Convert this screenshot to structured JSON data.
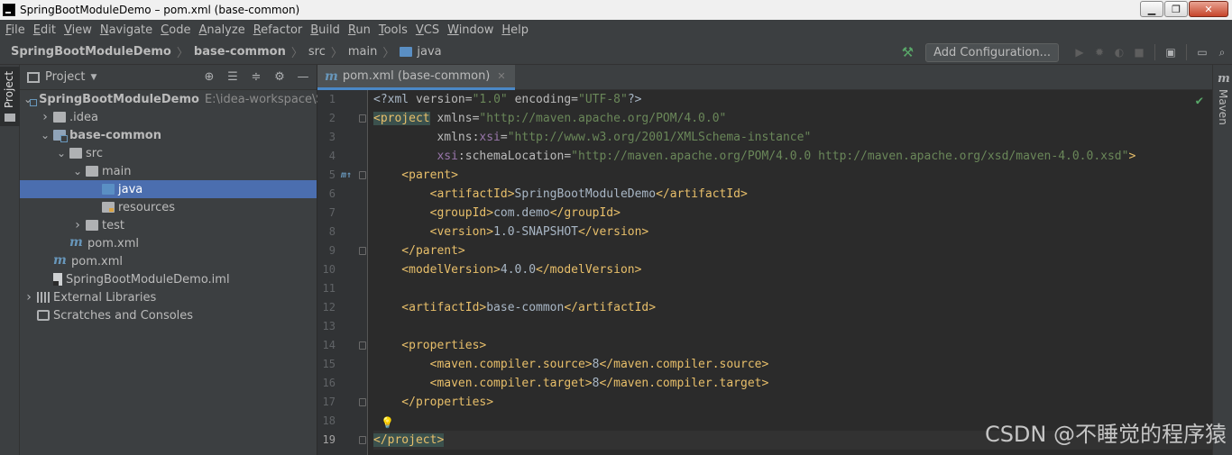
{
  "window": {
    "title": "SpringBootModuleDemo – pom.xml (base-common)",
    "buttons": {
      "minimize": "▁",
      "maximize": "❐",
      "close": "✕"
    }
  },
  "menu": [
    "File",
    "Edit",
    "View",
    "Navigate",
    "Code",
    "Analyze",
    "Refactor",
    "Build",
    "Run",
    "Tools",
    "VCS",
    "Window",
    "Help"
  ],
  "breadcrumb": [
    "SpringBootModuleDemo",
    "base-common",
    "src",
    "main",
    "java"
  ],
  "toolbar": {
    "add_configuration": "Add Configuration..."
  },
  "left_stripe": {
    "project_label": "Project"
  },
  "project_panel": {
    "title": "Project",
    "tree": [
      {
        "label": "SpringBootModuleDemo",
        "path": "E:\\idea-workspace\\Sp",
        "bold": true,
        "expanded": true,
        "depth": 0,
        "icon": "module-folder-icon"
      },
      {
        "label": ".idea",
        "expanded": false,
        "depth": 1,
        "icon": "folder-icon"
      },
      {
        "label": "base-common",
        "bold": true,
        "expanded": true,
        "depth": 1,
        "icon": "module-folder-icon"
      },
      {
        "label": "src",
        "expanded": true,
        "depth": 2,
        "icon": "folder-icon"
      },
      {
        "label": "main",
        "expanded": true,
        "depth": 3,
        "icon": "folder-icon"
      },
      {
        "label": "java",
        "depth": 4,
        "icon": "source-folder-icon",
        "selected": true
      },
      {
        "label": "resources",
        "depth": 4,
        "icon": "resources-folder-icon"
      },
      {
        "label": "test",
        "expanded": false,
        "depth": 3,
        "icon": "folder-icon"
      },
      {
        "label": "pom.xml",
        "depth": 2,
        "icon": "maven-icon"
      },
      {
        "label": "pom.xml",
        "depth": 1,
        "icon": "maven-icon"
      },
      {
        "label": "SpringBootModuleDemo.iml",
        "depth": 1,
        "icon": "iml-file-icon"
      },
      {
        "label": "External Libraries",
        "expanded": false,
        "depth": 0,
        "icon": "libraries-icon"
      },
      {
        "label": "Scratches and Consoles",
        "depth": 0,
        "icon": "scratches-icon"
      }
    ]
  },
  "editor": {
    "tab_label": "pom.xml (base-common)",
    "current_line": 19,
    "lines": [
      [
        [
          "t-text",
          "<?xml "
        ],
        [
          "t-attr",
          "version="
        ],
        [
          "t-val",
          "\"1.0\" "
        ],
        [
          "t-attr",
          "encoding="
        ],
        [
          "t-val",
          "\"UTF-8\""
        ],
        [
          "t-text",
          "?>"
        ]
      ],
      [
        [
          "t-tag t-hl",
          "<project"
        ],
        [
          "t-attr",
          " xmlns="
        ],
        [
          "t-val",
          "\"http://maven.apache.org/POM/4.0.0\""
        ]
      ],
      [
        [
          "t-attr",
          "         xmlns:"
        ],
        [
          "t-ns",
          "xsi"
        ],
        [
          "t-attr",
          "="
        ],
        [
          "t-val",
          "\"http://www.w3.org/2001/XMLSchema-instance\""
        ]
      ],
      [
        [
          "t-ns",
          "         xsi"
        ],
        [
          "t-attr",
          ":schemaLocation="
        ],
        [
          "t-val",
          "\"http://maven.apache.org/POM/4.0.0 http://maven.apache.org/xsd/maven-4.0.0.xsd\""
        ],
        [
          "t-tag",
          ">"
        ]
      ],
      [
        [
          "t-tag",
          "    <parent>"
        ]
      ],
      [
        [
          "t-tag",
          "        <artifactId>"
        ],
        [
          "t-text",
          "SpringBootModuleDemo"
        ],
        [
          "t-tag",
          "</artifactId>"
        ]
      ],
      [
        [
          "t-tag",
          "        <groupId>"
        ],
        [
          "t-text",
          "com.demo"
        ],
        [
          "t-tag",
          "</groupId>"
        ]
      ],
      [
        [
          "t-tag",
          "        <version>"
        ],
        [
          "t-text",
          "1.0-SNAPSHOT"
        ],
        [
          "t-tag",
          "</version>"
        ]
      ],
      [
        [
          "t-tag",
          "    </parent>"
        ]
      ],
      [
        [
          "t-tag",
          "    <modelVersion>"
        ],
        [
          "t-text",
          "4.0.0"
        ],
        [
          "t-tag",
          "</modelVersion>"
        ]
      ],
      [],
      [
        [
          "t-tag",
          "    <artifactId>"
        ],
        [
          "t-text",
          "base-common"
        ],
        [
          "t-tag",
          "</artifactId>"
        ]
      ],
      [],
      [
        [
          "t-tag",
          "    <properties>"
        ]
      ],
      [
        [
          "t-tag",
          "        <maven.compiler.source>"
        ],
        [
          "t-text",
          "8"
        ],
        [
          "t-tag",
          "</maven.compiler.source>"
        ]
      ],
      [
        [
          "t-tag",
          "        <maven.compiler.target>"
        ],
        [
          "t-text",
          "8"
        ],
        [
          "t-tag",
          "</maven.compiler.target>"
        ]
      ],
      [
        [
          "t-tag",
          "    </properties>"
        ]
      ],
      [],
      [
        [
          "t-tag t-hl",
          "</project>"
        ]
      ]
    ],
    "fold_lines": [
      2,
      5,
      9,
      14,
      17,
      19
    ],
    "gutter_mark_line": 5,
    "gutter_mark": "m↑",
    "bulb_line": 18
  },
  "right_stripe": {
    "label": "Maven"
  },
  "watermark": "CSDN @不睡觉的程序猿"
}
